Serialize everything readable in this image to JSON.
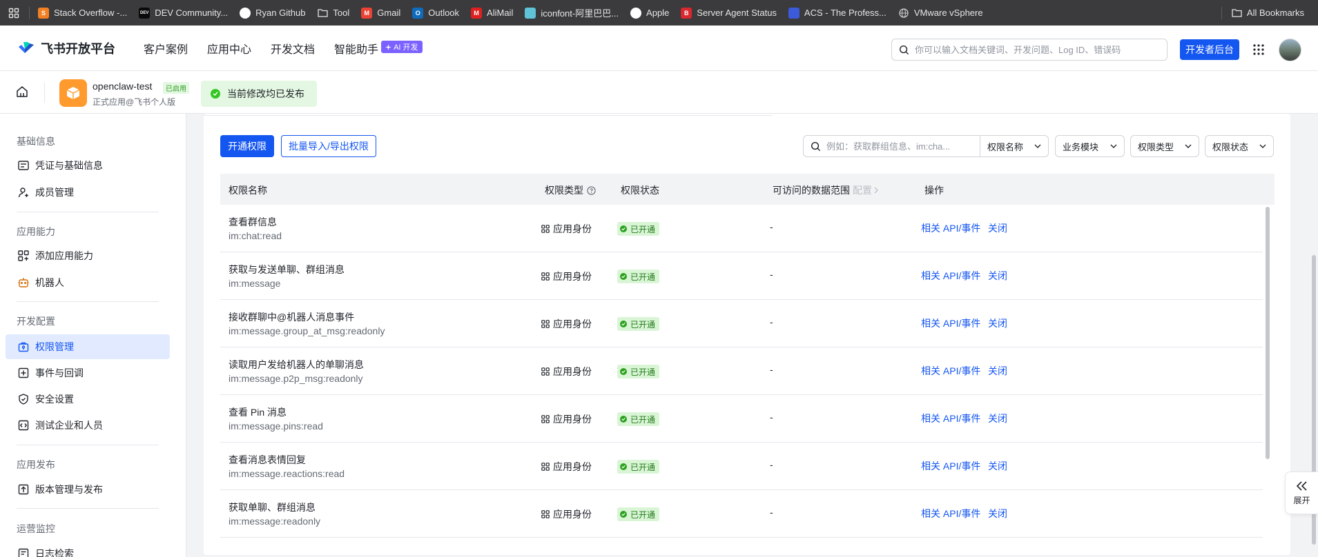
{
  "bookmarks": {
    "items": [
      {
        "label": "Stack Overflow -...",
        "icon": "stackoverflow-icon",
        "color": "#f48024"
      },
      {
        "label": "DEV Community...",
        "icon": "dev-icon",
        "color": "#0a0a0a"
      },
      {
        "label": "Ryan Github",
        "icon": "github-icon",
        "color": "#ffffff"
      },
      {
        "label": "Tool",
        "icon": "folder-icon",
        "color": "#e6e6e6"
      },
      {
        "label": "Gmail",
        "icon": "gmail-icon",
        "color": "#ea4335"
      },
      {
        "label": "Outlook",
        "icon": "outlook-icon",
        "color": "#0f6cbd"
      },
      {
        "label": "AliMail",
        "icon": "alimail-icon",
        "color": "#e02020"
      },
      {
        "label": "iconfont-阿里巴巴...",
        "icon": "iconfont-icon",
        "color": "#5fc4d6"
      },
      {
        "label": "Apple",
        "icon": "apple-icon",
        "color": "#ffffff"
      },
      {
        "label": "Server Agent Status",
        "icon": "server-icon",
        "color": "#d9282f"
      },
      {
        "label": "ACS - The Profess...",
        "icon": "acs-icon",
        "color": "#3b5bdb"
      },
      {
        "label": "VMware vSphere",
        "icon": "globe-icon",
        "color": "#cfcfcf"
      }
    ],
    "all_bookmarks": "All Bookmarks"
  },
  "topnav": {
    "brand": "飞书开放平台",
    "nav": [
      "客户案例",
      "应用中心",
      "开发文档",
      "智能助手"
    ],
    "ai_badge": "AI 开发",
    "search_placeholder": "你可以输入文档关键词、开发问题、Log ID、错误码",
    "dev_button": "开发者后台"
  },
  "app": {
    "name": "openclaw-test",
    "status": "已启用",
    "subtitle": "正式应用@飞书个人版",
    "publish_message": "当前修改均已发布"
  },
  "sidebar": {
    "groups": [
      {
        "title": "基础信息",
        "items": [
          {
            "label": "凭证与基础信息",
            "icon": "credential-icon"
          },
          {
            "label": "成员管理",
            "icon": "member-icon"
          }
        ]
      },
      {
        "title": "应用能力",
        "items": [
          {
            "label": "添加应用能力",
            "icon": "add-capability-icon"
          },
          {
            "label": "机器人",
            "icon": "robot-icon"
          }
        ]
      },
      {
        "title": "开发配置",
        "items": [
          {
            "label": "权限管理",
            "icon": "permission-icon",
            "active": true
          },
          {
            "label": "事件与回调",
            "icon": "event-icon"
          },
          {
            "label": "安全设置",
            "icon": "shield-icon"
          },
          {
            "label": "测试企业和人员",
            "icon": "test-icon"
          }
        ]
      },
      {
        "title": "应用发布",
        "items": [
          {
            "label": "版本管理与发布",
            "icon": "upload-icon"
          }
        ]
      },
      {
        "title": "运营监控",
        "items": [
          {
            "label": "日志检索",
            "icon": "log-icon"
          }
        ]
      }
    ]
  },
  "toolbar": {
    "open_permission": "开通权限",
    "batch_import_export": "批量导入/导出权限",
    "search_placeholder": "例如：获取群组信息、im:cha...",
    "filters": [
      "权限名称",
      "业务模块",
      "权限类型",
      "权限状态"
    ]
  },
  "table": {
    "headers": {
      "name": "权限名称",
      "type": "权限类型",
      "status": "权限状态",
      "scope": "可访问的数据范围",
      "scope_config": "配置",
      "actions": "操作"
    },
    "rows": [
      {
        "name": "查看群信息",
        "code": "im:chat:read",
        "type": "应用身份",
        "status": "已开通",
        "scope": "-",
        "link": "相关 API/事件",
        "close": "关闭"
      },
      {
        "name": "获取与发送单聊、群组消息",
        "code": "im:message",
        "type": "应用身份",
        "status": "已开通",
        "scope": "-",
        "link": "相关 API/事件",
        "close": "关闭"
      },
      {
        "name": "接收群聊中@机器人消息事件",
        "code": "im:message.group_at_msg:readonly",
        "type": "应用身份",
        "status": "已开通",
        "scope": "-",
        "link": "相关 API/事件",
        "close": "关闭"
      },
      {
        "name": "读取用户发给机器人的单聊消息",
        "code": "im:message.p2p_msg:readonly",
        "type": "应用身份",
        "status": "已开通",
        "scope": "-",
        "link": "相关 API/事件",
        "close": "关闭"
      },
      {
        "name": "查看 Pin 消息",
        "code": "im:message.pins:read",
        "type": "应用身份",
        "status": "已开通",
        "scope": "-",
        "link": "相关 API/事件",
        "close": "关闭"
      },
      {
        "name": "查看消息表情回复",
        "code": "im:message.reactions:read",
        "type": "应用身份",
        "status": "已开通",
        "scope": "-",
        "link": "相关 API/事件",
        "close": "关闭"
      },
      {
        "name": "获取单聊、群组消息",
        "code": "im:message:readonly",
        "type": "应用身份",
        "status": "已开通",
        "scope": "-",
        "link": "相关 API/事件",
        "close": "关闭"
      }
    ]
  },
  "expand_label": "展开",
  "colors": {
    "primary": "#1456f0",
    "success": "#2ea121",
    "ai": "#7b61ff"
  }
}
